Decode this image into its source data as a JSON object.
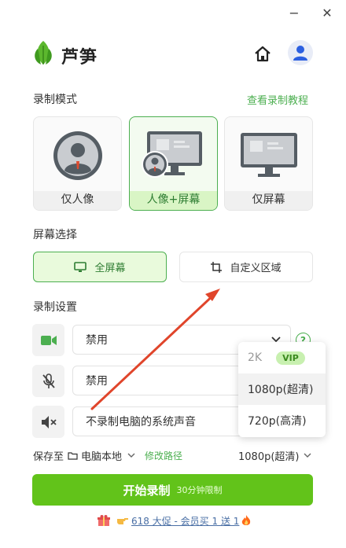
{
  "window": {
    "minimize": "−",
    "close": "✕"
  },
  "app": {
    "name": "芦笋"
  },
  "record_mode": {
    "title": "录制模式",
    "tutorial_link": "查看录制教程",
    "options": [
      {
        "label": "仅人像"
      },
      {
        "label": "人像+屏幕"
      },
      {
        "label": "仅屏幕"
      }
    ],
    "selected": "人像+屏幕"
  },
  "screen_select": {
    "title": "屏幕选择",
    "options": [
      {
        "label": "全屏幕"
      },
      {
        "label": "自定义区域"
      }
    ],
    "selected": "全屏幕"
  },
  "record_settings": {
    "title": "录制设置",
    "camera": {
      "value": "禁用"
    },
    "microphone": {
      "value": "禁用"
    },
    "system_audio": {
      "value": "不录制电脑的系统声音"
    },
    "help": "?"
  },
  "resolution_menu": {
    "items": [
      {
        "label": "2K",
        "badge": "VIP"
      },
      {
        "label": "1080p(超清)"
      },
      {
        "label": "720p(高清)"
      }
    ]
  },
  "save": {
    "label": "保存至",
    "location": "电脑本地",
    "modify_link": "修改路径",
    "resolution": "1080p(超清)"
  },
  "start": {
    "label": "开始录制",
    "limit": "30分钟限制"
  },
  "promo": {
    "text": "618 大促 - 会员买 1 送 1"
  },
  "colors": {
    "accent": "#62c31a",
    "link": "#4caf50",
    "annotation_arrow": "#e0452b"
  }
}
